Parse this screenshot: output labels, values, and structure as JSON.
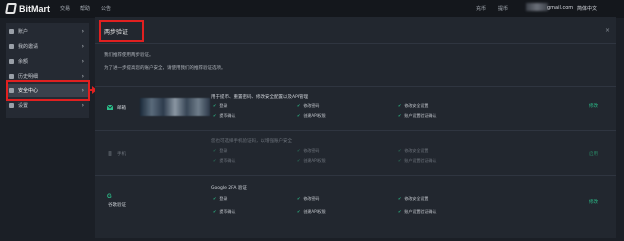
{
  "app": {
    "name": "BitMart"
  },
  "topnav": {
    "items": [
      "交易",
      "帮助",
      "公告"
    ]
  },
  "topright": {
    "deposit": "充币",
    "withdraw": "提币",
    "user": "gmail.com",
    "lang": "简体中文"
  },
  "sidebar": {
    "items": [
      {
        "label": "账户",
        "icon": "user-icon"
      },
      {
        "label": "我的邀请",
        "icon": "gift-icon"
      },
      {
        "label": "余额",
        "icon": "wallet-icon"
      },
      {
        "label": "历史明细",
        "icon": "history-icon"
      },
      {
        "label": "安全中心",
        "icon": "shield-icon",
        "active": true
      },
      {
        "label": "设置",
        "icon": "settings-icon"
      }
    ]
  },
  "page": {
    "title": "两步验证",
    "intro1": "我们推荐使用两步验证。",
    "intro2": "为了进一步提高您的账户安全，请使用我们的推荐验证选项。"
  },
  "methods": [
    {
      "label": "邮箱",
      "icon": "email-icon",
      "desc": "用于提币、重置密码、修改安全配置以及API管理",
      "features": [
        "登录",
        "修改密码",
        "修改安全设置",
        "提币确认",
        "创建API权限",
        "账户设置验证确认"
      ],
      "action": "修改"
    },
    {
      "label": "手机",
      "icon": "phone-icon",
      "desc": "您也可选择手机验证码，以增强账户安全",
      "features": [
        "登录",
        "修改密码",
        "修改安全设置",
        "提币确认",
        "创建API权限",
        "账户设置验证确认"
      ],
      "action": "启用"
    },
    {
      "label": "谷歌验证",
      "icon": "google-icon",
      "desc": "Google 2FA 验证",
      "features": [
        "登录",
        "修改密码",
        "修改安全设置",
        "提币确认",
        "创建API权限",
        "账户设置验证确认"
      ],
      "action": "修改"
    }
  ],
  "colors": {
    "accent": "#2bbf8a",
    "highlight": "#e02020"
  }
}
